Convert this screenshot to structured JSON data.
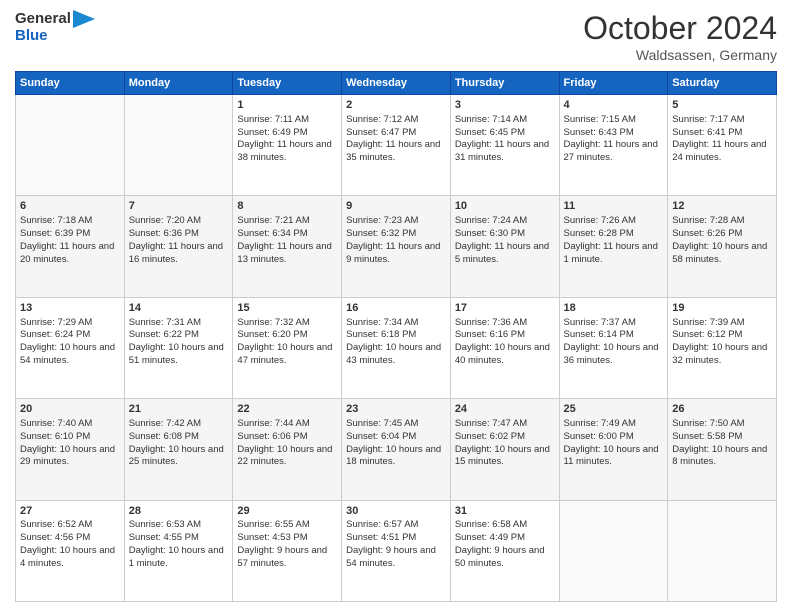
{
  "logo": {
    "general": "General",
    "blue": "Blue"
  },
  "title": "October 2024",
  "location": "Waldsassen, Germany",
  "days_of_week": [
    "Sunday",
    "Monday",
    "Tuesday",
    "Wednesday",
    "Thursday",
    "Friday",
    "Saturday"
  ],
  "weeks": [
    [
      {
        "day": "",
        "info": ""
      },
      {
        "day": "",
        "info": ""
      },
      {
        "day": "1",
        "info": "Sunrise: 7:11 AM\nSunset: 6:49 PM\nDaylight: 11 hours and 38 minutes."
      },
      {
        "day": "2",
        "info": "Sunrise: 7:12 AM\nSunset: 6:47 PM\nDaylight: 11 hours and 35 minutes."
      },
      {
        "day": "3",
        "info": "Sunrise: 7:14 AM\nSunset: 6:45 PM\nDaylight: 11 hours and 31 minutes."
      },
      {
        "day": "4",
        "info": "Sunrise: 7:15 AM\nSunset: 6:43 PM\nDaylight: 11 hours and 27 minutes."
      },
      {
        "day": "5",
        "info": "Sunrise: 7:17 AM\nSunset: 6:41 PM\nDaylight: 11 hours and 24 minutes."
      }
    ],
    [
      {
        "day": "6",
        "info": "Sunrise: 7:18 AM\nSunset: 6:39 PM\nDaylight: 11 hours and 20 minutes."
      },
      {
        "day": "7",
        "info": "Sunrise: 7:20 AM\nSunset: 6:36 PM\nDaylight: 11 hours and 16 minutes."
      },
      {
        "day": "8",
        "info": "Sunrise: 7:21 AM\nSunset: 6:34 PM\nDaylight: 11 hours and 13 minutes."
      },
      {
        "day": "9",
        "info": "Sunrise: 7:23 AM\nSunset: 6:32 PM\nDaylight: 11 hours and 9 minutes."
      },
      {
        "day": "10",
        "info": "Sunrise: 7:24 AM\nSunset: 6:30 PM\nDaylight: 11 hours and 5 minutes."
      },
      {
        "day": "11",
        "info": "Sunrise: 7:26 AM\nSunset: 6:28 PM\nDaylight: 11 hours and 1 minute."
      },
      {
        "day": "12",
        "info": "Sunrise: 7:28 AM\nSunset: 6:26 PM\nDaylight: 10 hours and 58 minutes."
      }
    ],
    [
      {
        "day": "13",
        "info": "Sunrise: 7:29 AM\nSunset: 6:24 PM\nDaylight: 10 hours and 54 minutes."
      },
      {
        "day": "14",
        "info": "Sunrise: 7:31 AM\nSunset: 6:22 PM\nDaylight: 10 hours and 51 minutes."
      },
      {
        "day": "15",
        "info": "Sunrise: 7:32 AM\nSunset: 6:20 PM\nDaylight: 10 hours and 47 minutes."
      },
      {
        "day": "16",
        "info": "Sunrise: 7:34 AM\nSunset: 6:18 PM\nDaylight: 10 hours and 43 minutes."
      },
      {
        "day": "17",
        "info": "Sunrise: 7:36 AM\nSunset: 6:16 PM\nDaylight: 10 hours and 40 minutes."
      },
      {
        "day": "18",
        "info": "Sunrise: 7:37 AM\nSunset: 6:14 PM\nDaylight: 10 hours and 36 minutes."
      },
      {
        "day": "19",
        "info": "Sunrise: 7:39 AM\nSunset: 6:12 PM\nDaylight: 10 hours and 32 minutes."
      }
    ],
    [
      {
        "day": "20",
        "info": "Sunrise: 7:40 AM\nSunset: 6:10 PM\nDaylight: 10 hours and 29 minutes."
      },
      {
        "day": "21",
        "info": "Sunrise: 7:42 AM\nSunset: 6:08 PM\nDaylight: 10 hours and 25 minutes."
      },
      {
        "day": "22",
        "info": "Sunrise: 7:44 AM\nSunset: 6:06 PM\nDaylight: 10 hours and 22 minutes."
      },
      {
        "day": "23",
        "info": "Sunrise: 7:45 AM\nSunset: 6:04 PM\nDaylight: 10 hours and 18 minutes."
      },
      {
        "day": "24",
        "info": "Sunrise: 7:47 AM\nSunset: 6:02 PM\nDaylight: 10 hours and 15 minutes."
      },
      {
        "day": "25",
        "info": "Sunrise: 7:49 AM\nSunset: 6:00 PM\nDaylight: 10 hours and 11 minutes."
      },
      {
        "day": "26",
        "info": "Sunrise: 7:50 AM\nSunset: 5:58 PM\nDaylight: 10 hours and 8 minutes."
      }
    ],
    [
      {
        "day": "27",
        "info": "Sunrise: 6:52 AM\nSunset: 4:56 PM\nDaylight: 10 hours and 4 minutes."
      },
      {
        "day": "28",
        "info": "Sunrise: 6:53 AM\nSunset: 4:55 PM\nDaylight: 10 hours and 1 minute."
      },
      {
        "day": "29",
        "info": "Sunrise: 6:55 AM\nSunset: 4:53 PM\nDaylight: 9 hours and 57 minutes."
      },
      {
        "day": "30",
        "info": "Sunrise: 6:57 AM\nSunset: 4:51 PM\nDaylight: 9 hours and 54 minutes."
      },
      {
        "day": "31",
        "info": "Sunrise: 6:58 AM\nSunset: 4:49 PM\nDaylight: 9 hours and 50 minutes."
      },
      {
        "day": "",
        "info": ""
      },
      {
        "day": "",
        "info": ""
      }
    ]
  ]
}
